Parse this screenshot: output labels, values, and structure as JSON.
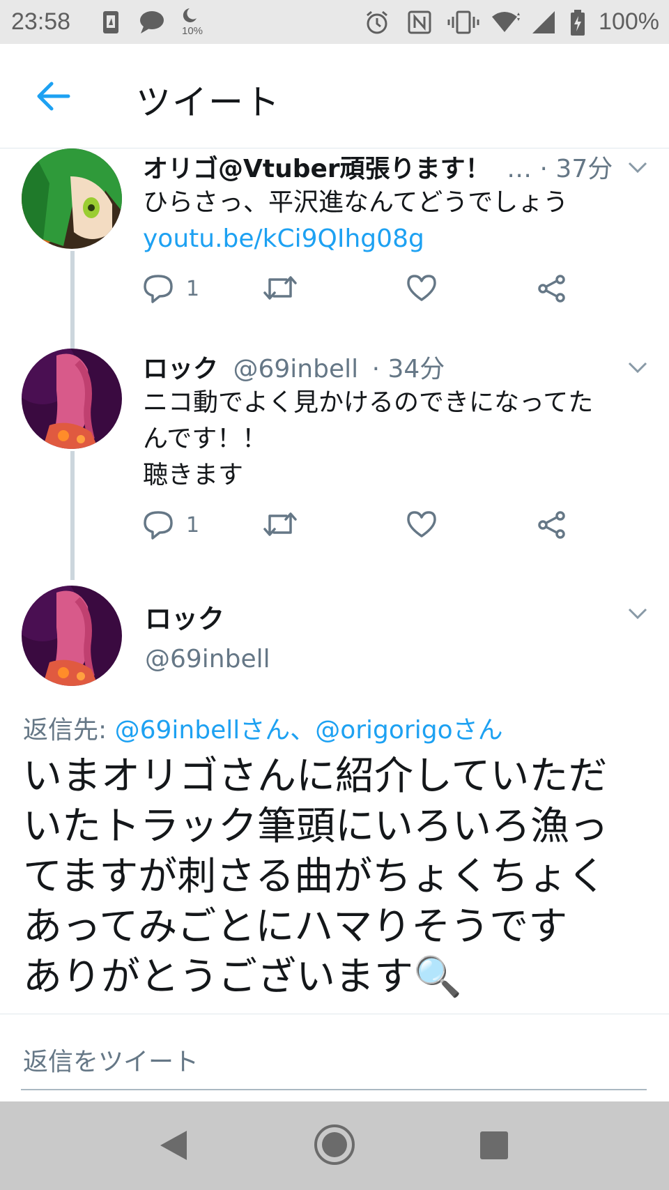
{
  "status_bar": {
    "time": "23:58",
    "moon_percent": "10%",
    "battery": "100%"
  },
  "header": {
    "title": "ツイート"
  },
  "tweets": [
    {
      "name": "オリゴ@Vtuber頑張ります！",
      "ellipsis": "…",
      "time": "· 37分",
      "text": "ひらさっ、平沢進なんてどうでしょう",
      "link": "youtu.be/kCi9QIhg08g",
      "reply_count": "1"
    },
    {
      "name": "ロック",
      "handle": "@69inbell",
      "time": "· 34分",
      "text_lines": [
        "ニコ動でよく見かけるのできになってた",
        "んです！！",
        "聴きます"
      ],
      "reply_count": "1"
    }
  ],
  "main_tweet": {
    "name": "ロック",
    "handle": "@69inbell",
    "reply_to_label": "返信先:",
    "reply_to_users": "@69inbellさん、@origorigoさん",
    "text_lines": [
      "いまオリゴさんに紹介していただ",
      "いたトラック筆頭にいろいろ漁っ",
      "てますが刺さる曲がちょくちょく",
      "あってみごとにハマりそうです",
      "ありがとうございます🔍"
    ]
  },
  "reply_box": {
    "placeholder": "返信をツイート"
  },
  "colors": {
    "accent": "#1da1f2",
    "secondary_text": "#657786",
    "thread_line": "#ccd6dd"
  }
}
